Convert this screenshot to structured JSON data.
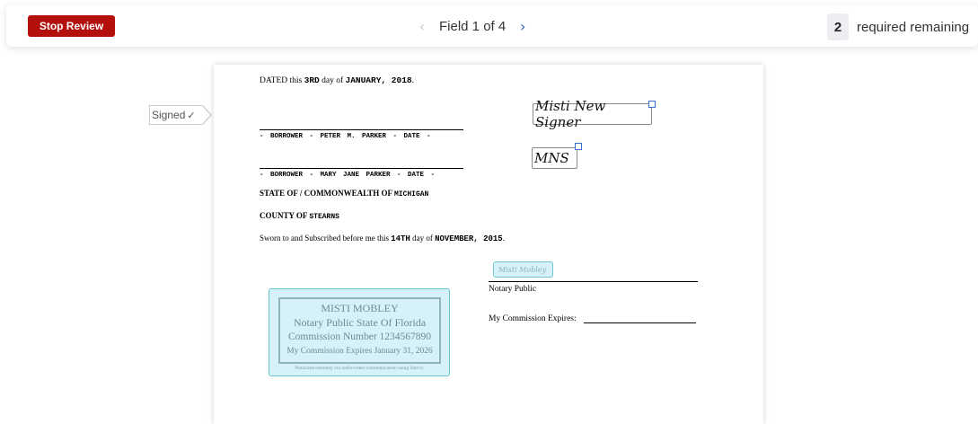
{
  "toolbar": {
    "stop_label": "Stop Review",
    "prev_icon": "chevron-left-icon",
    "next_icon": "chevron-right-icon",
    "field_label": "Field 1 of 4",
    "required_count": "2",
    "required_text": "required remaining"
  },
  "signed_tag": {
    "label": "Signed",
    "check": "✓"
  },
  "document": {
    "dated_prefix": "DATED this ",
    "dated_day": "3RD",
    "dated_mid": " day of ",
    "dated_month": "JANUARY, 2018",
    "dated_suffix": ".",
    "borrower1": "- BORROWER - PETER M. PARKER - DATE -",
    "borrower2": "- BORROWER - MARY JANE PARKER - DATE -",
    "state_prefix": "STATE OF / COMMONWEALTH OF ",
    "state_value": "MICHIGAN",
    "county_prefix": "COUNTY OF ",
    "county_value": "STEARNS",
    "sworn_prefix": "Sworn to and Subscribed before me this ",
    "sworn_day": "14TH",
    "sworn_mid": " day of ",
    "sworn_month": "NOVEMBER, 2015",
    "sworn_suffix": ".",
    "signature_full": "Misti New Signer",
    "signature_initials": "MNS",
    "notary_signature": "Misti Mobley",
    "notary_public_label": "Notary Public",
    "commission_expires_label": "My Commission Expires: "
  },
  "seal": {
    "name": "MISTI MOBLEY",
    "line2": "Notary Public State Of Florida",
    "line3": "Commission Number 1234567890",
    "line4": "My Commission Expires January 31, 2026",
    "footer": "Notarized remotely via audio/video communication using Stavvy"
  },
  "colors": {
    "stop_button": "#b30f0c",
    "seal_fill": "#d6f2f8",
    "handle": "#3a6fd0"
  }
}
